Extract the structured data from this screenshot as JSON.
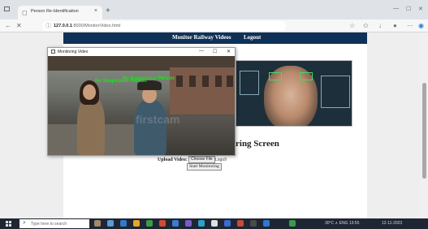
{
  "browser": {
    "tab_title": "Person Re-Identification",
    "url_host": "127.0.0.1",
    "url_path": ":8000/MonitorVideo.html",
    "tab_close_glyph": "×",
    "new_tab_glyph": "+",
    "icons": [
      "back-icon",
      "reload-icon",
      "info-icon",
      "favorite-icon",
      "collections-icon",
      "downloads-icon",
      "profile-icon",
      "more-icon",
      "edge-icon"
    ]
  },
  "page": {
    "nav": {
      "monitor_link": "Monitor Railway Videos",
      "logout_link": "Logout"
    },
    "heading": "ring Screen",
    "upload_label": "Upload Video:",
    "file_button": "Choose File",
    "file_status": "Logo9",
    "start_button": "Start Monitoring"
  },
  "popup": {
    "title": "Monitoring Video",
    "min_glyph": "—",
    "max_glyph": "☐",
    "close_glyph": "✕",
    "labels": [
      "No Suspicious Person",
      "No Suspicious Person"
    ],
    "watermark": "firstcam"
  },
  "taskbar": {
    "search_placeholder": "Type here to search",
    "tray_text": "30°C  ∧  ENG  13:55",
    "tray_date": "12-11-2023"
  },
  "colors": {
    "navbar": "#0f3158",
    "detection_label": "#19e619",
    "taskbar": "#1f2633"
  }
}
